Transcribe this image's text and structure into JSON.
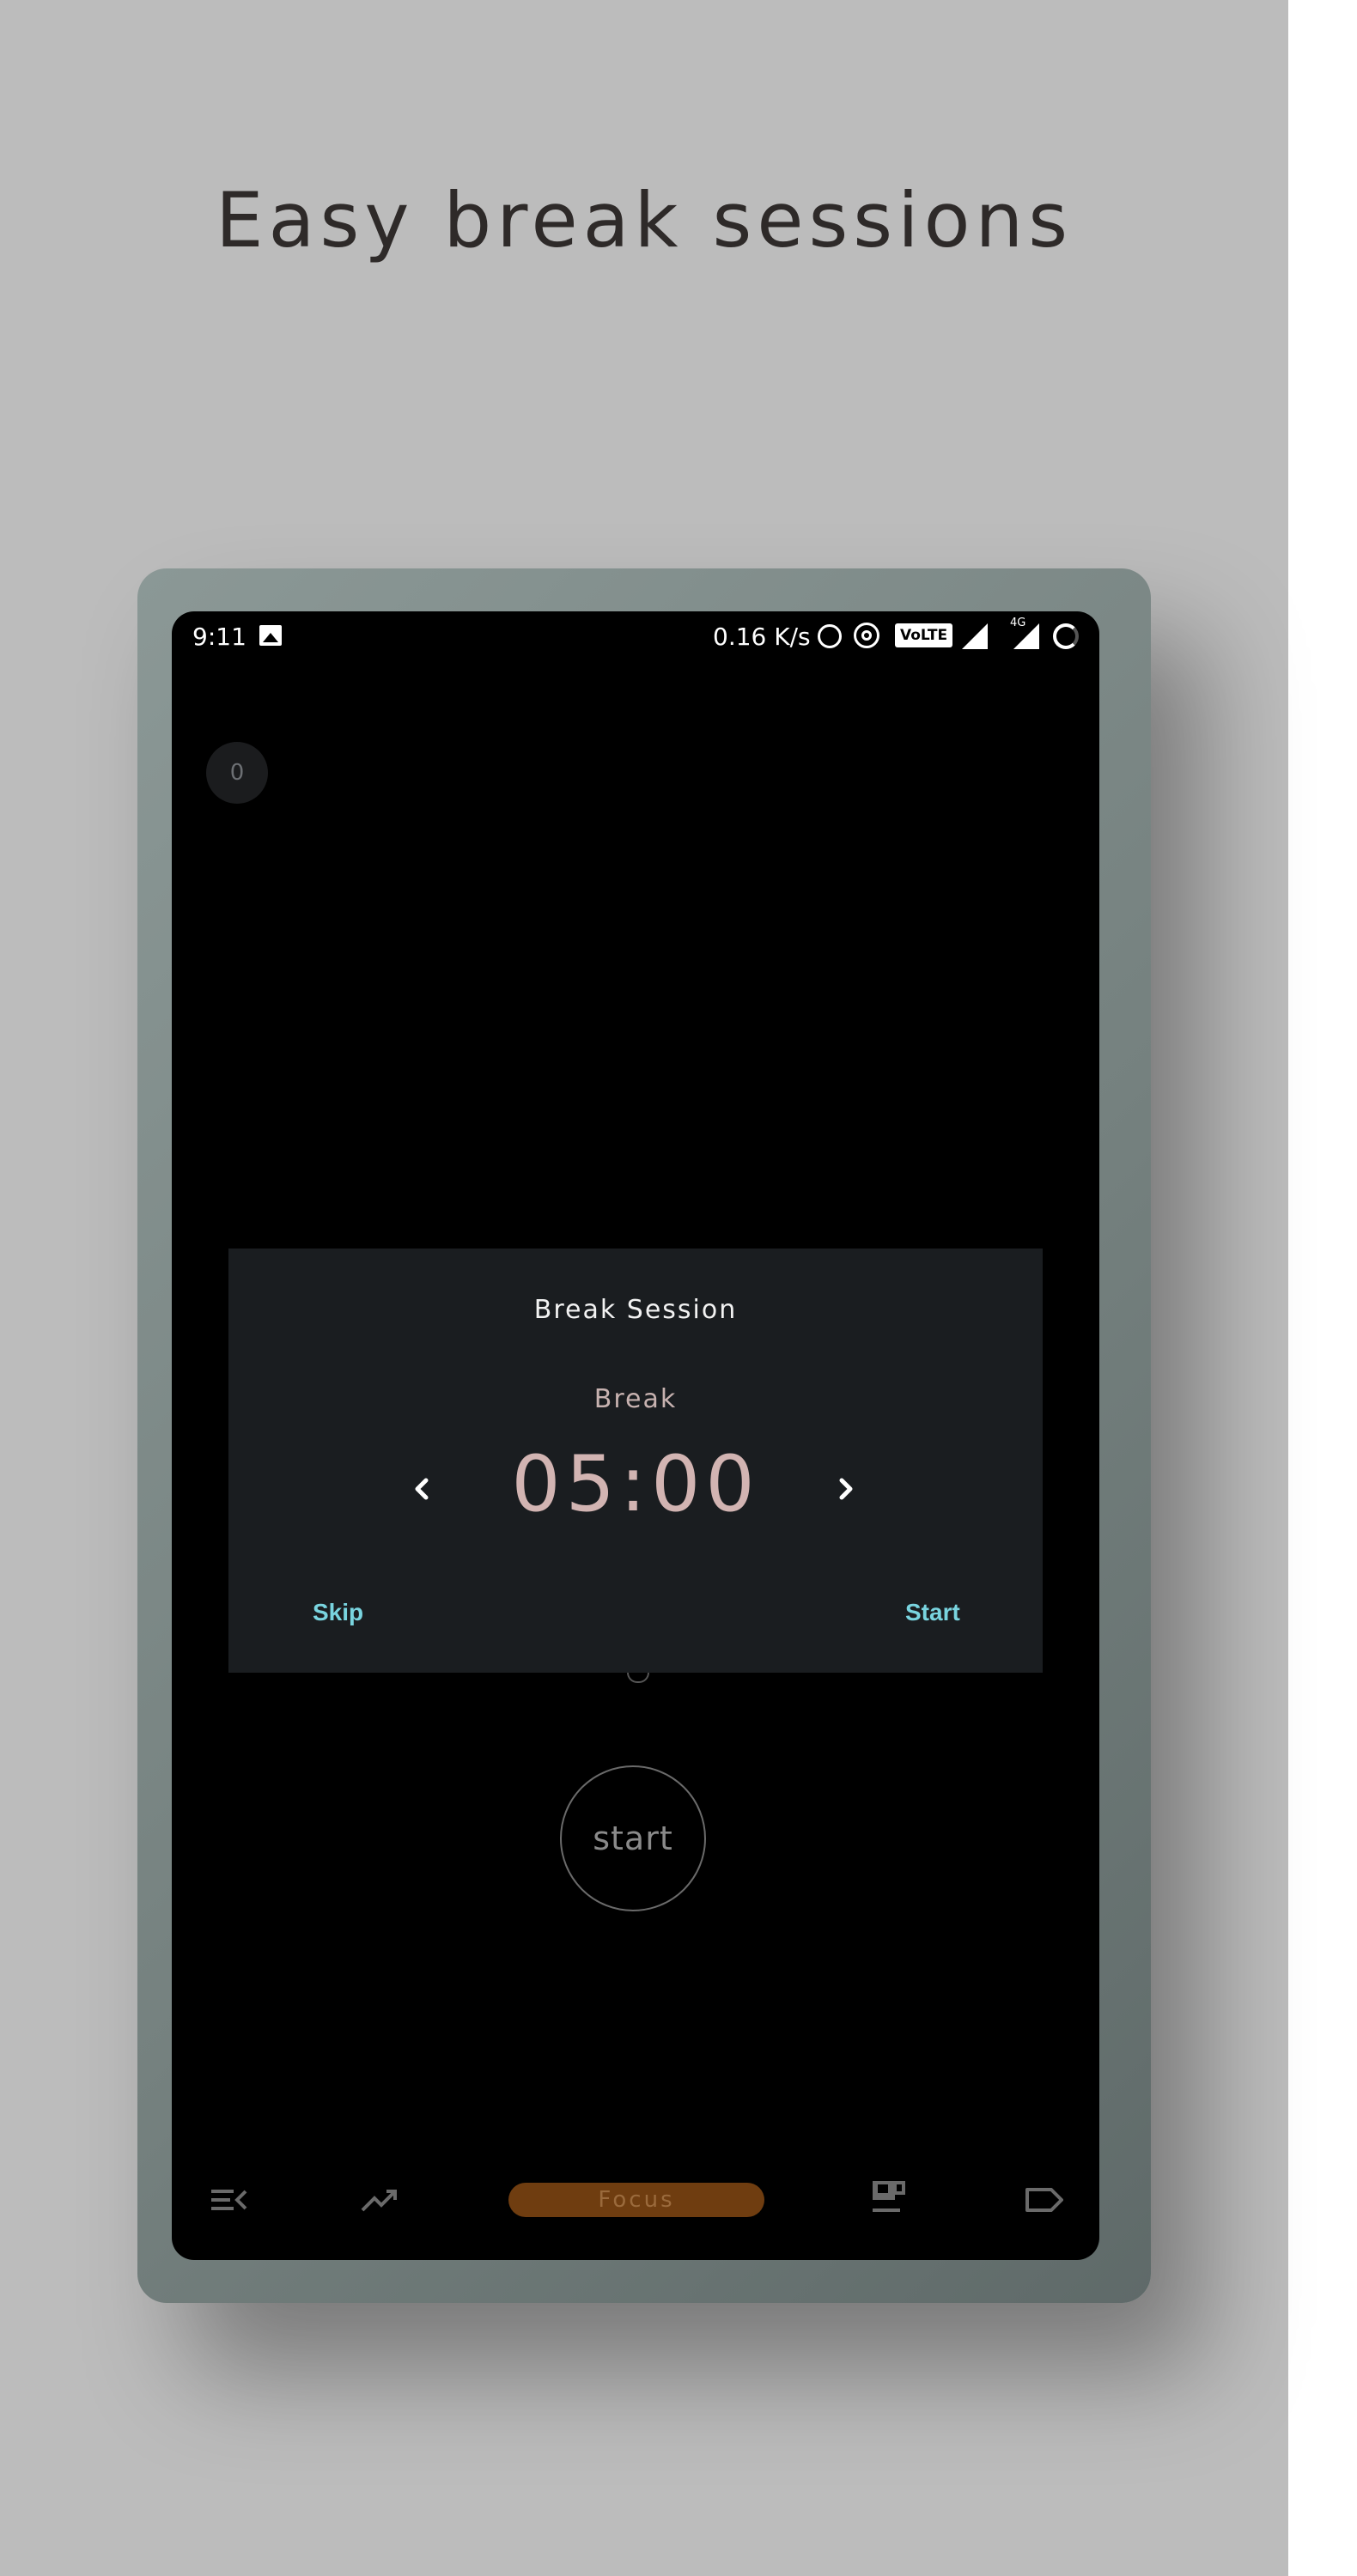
{
  "headline": "Easy break sessions",
  "status_bar": {
    "time": "9:11",
    "network_speed": "0.16 K/s",
    "volte": "VoLTE",
    "network_type": "4G",
    "icons": [
      "image-icon",
      "alarm-icon",
      "hotspot-icon",
      "signal-icon",
      "battery-icon"
    ]
  },
  "counter": "0",
  "dialog": {
    "title": "Break Session",
    "session_label": "Break",
    "duration": "05:00",
    "skip_label": "Skip",
    "start_label": "Start"
  },
  "start_button": "start",
  "bottom_nav": {
    "focus_label": "Focus",
    "items": [
      "queue-icon",
      "trend-icon",
      "focus",
      "break-cup-icon",
      "label-icon"
    ]
  },
  "colors": {
    "background": "#bcbcbc",
    "dialog_bg": "#1a1d20",
    "accent_button": "#79d4df",
    "timer_text": "#d2b4b2",
    "focus_pill": "#6f3d10"
  }
}
